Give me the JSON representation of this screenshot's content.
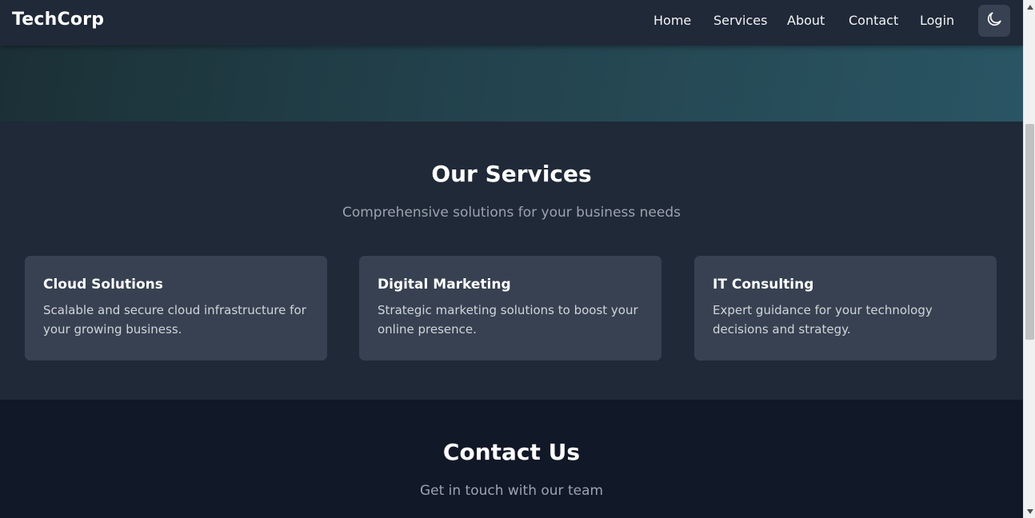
{
  "navbar": {
    "brand": "TechCorp",
    "links": [
      "Home",
      "Services",
      "About",
      "Contact",
      "Login"
    ],
    "theme_toggle_icon": "moon-icon"
  },
  "services": {
    "title": "Our Services",
    "subtitle": "Comprehensive solutions for your business needs",
    "cards": [
      {
        "title": "Cloud Solutions",
        "description": "Scalable and secure cloud infrastructure for your growing business."
      },
      {
        "title": "Digital Marketing",
        "description": "Strategic marketing solutions to boost your online presence."
      },
      {
        "title": "IT Consulting",
        "description": "Expert guidance for your technology decisions and strategy."
      }
    ]
  },
  "contact": {
    "title": "Contact Us",
    "subtitle": "Get in touch with our team"
  },
  "colors": {
    "navbar_bg": "#1f2937",
    "services_bg": "#1f2937",
    "card_bg": "#374151",
    "contact_bg": "#111827",
    "muted_text": "#9ca3af"
  }
}
